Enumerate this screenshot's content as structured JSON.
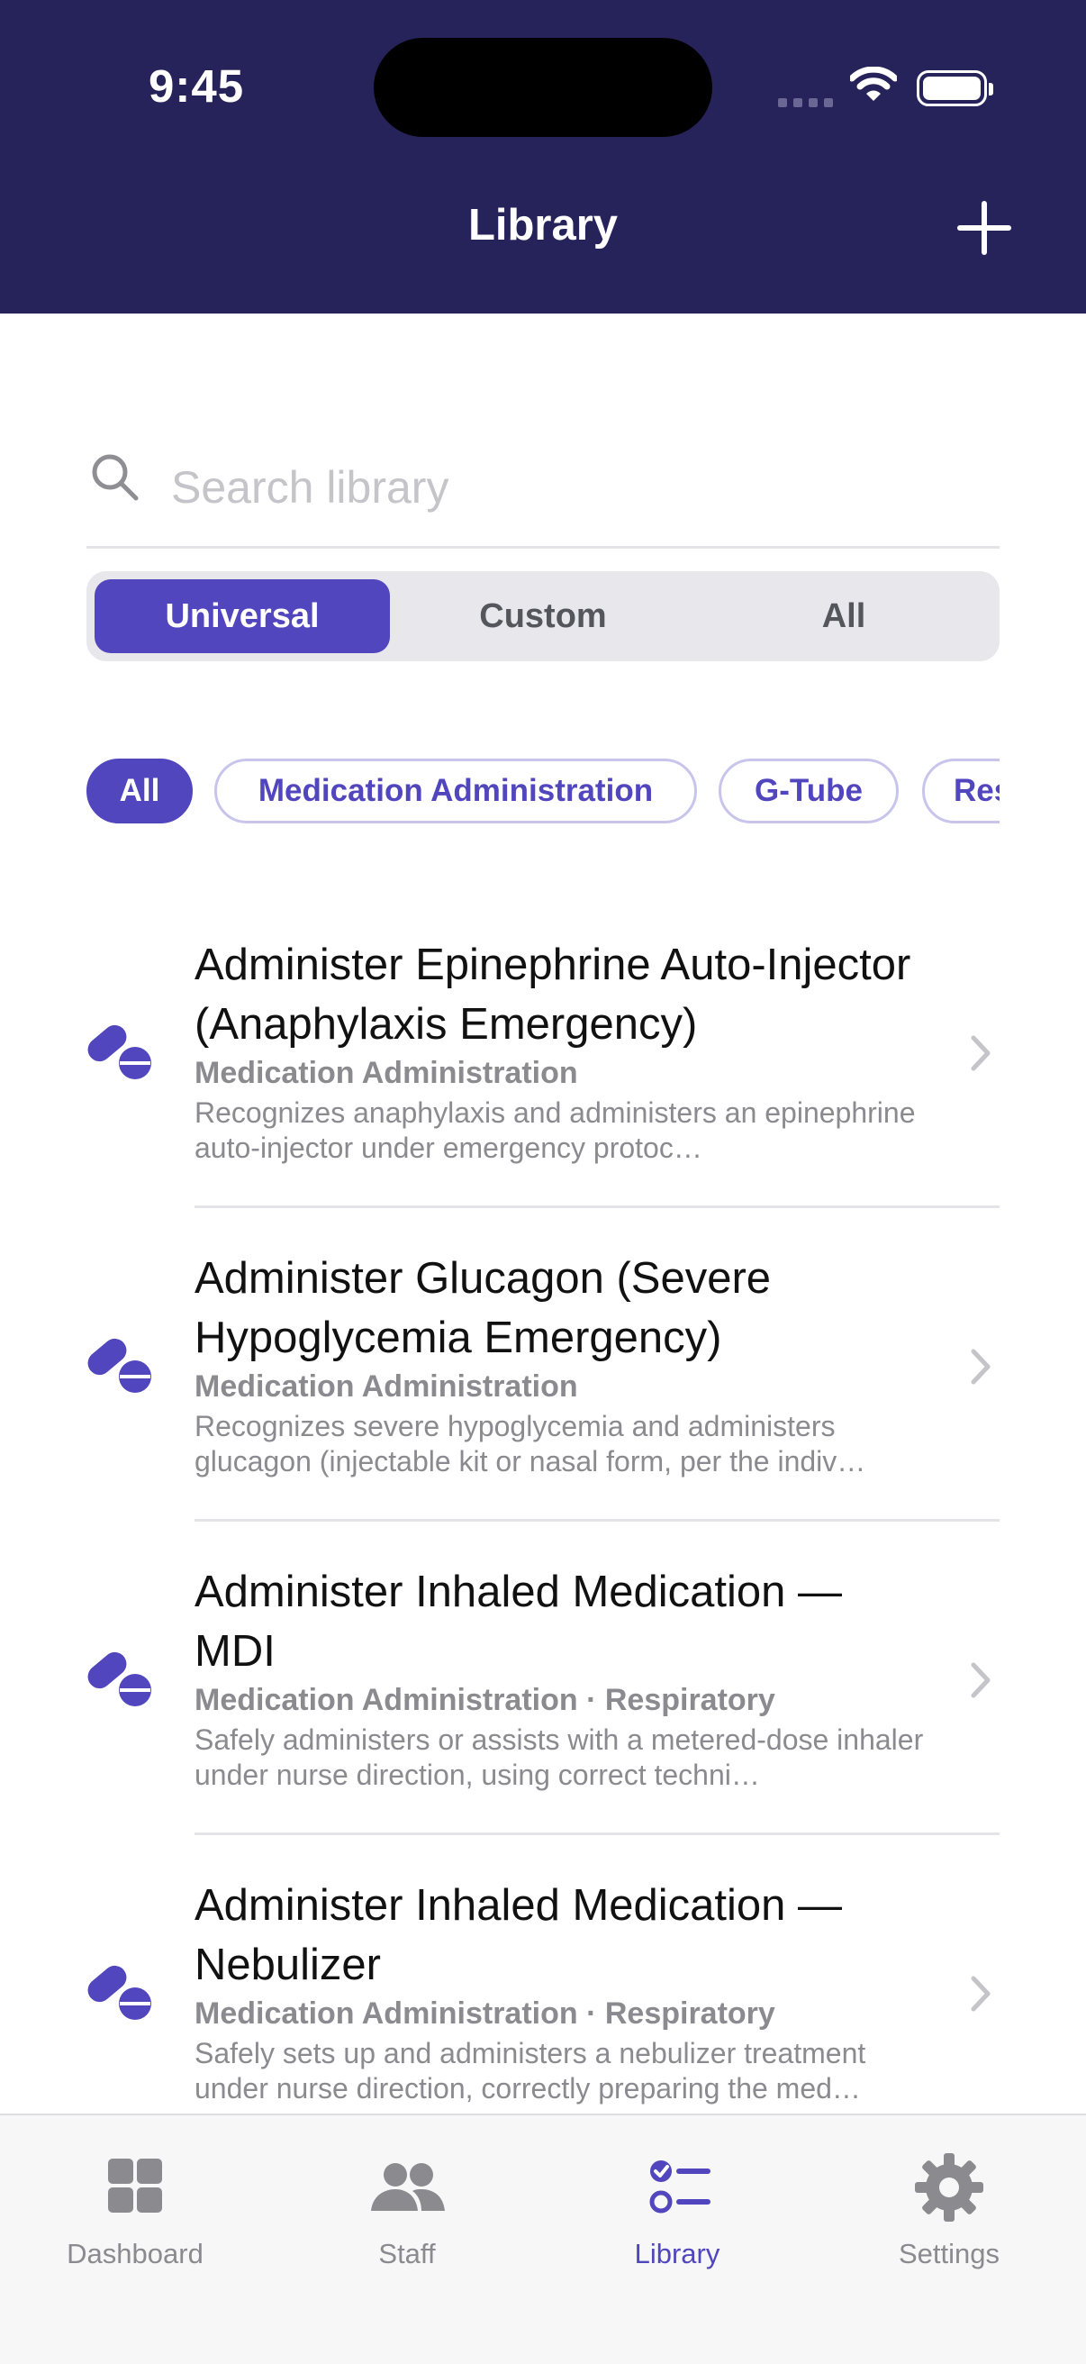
{
  "status_bar": {
    "time": "9:45"
  },
  "header": {
    "title": "Library",
    "add_icon": "plus-icon"
  },
  "search": {
    "placeholder": "Search library",
    "value": ""
  },
  "segments": [
    {
      "label": "Universal",
      "active": true
    },
    {
      "label": "Custom",
      "active": false
    },
    {
      "label": "All",
      "active": false
    }
  ],
  "filter_chips": [
    {
      "label": "All",
      "active": true
    },
    {
      "label": "Medication Administration",
      "active": false
    },
    {
      "label": "G-Tube",
      "active": false
    },
    {
      "label": "Res",
      "active": false
    }
  ],
  "items": [
    {
      "title": "Administer Epinephrine Auto-Injector (Anaphylaxis Emergency)",
      "category": "Medication Administration",
      "description": "Recognizes anaphylaxis and administers an epinephrine auto-injector under emergency protoc…",
      "icon": "pills-icon"
    },
    {
      "title": "Administer Glucagon (Severe Hypoglycemia Emergency)",
      "category": "Medication Administration",
      "description": "Recognizes severe hypoglycemia and administers glucagon (injectable kit or nasal form, per the indiv…",
      "icon": "pills-icon"
    },
    {
      "title": "Administer Inhaled Medication — MDI",
      "category": "Medication Administration · Respiratory",
      "description": "Safely administers or assists with a metered-dose inhaler under nurse direction, using correct techni…",
      "icon": "pills-icon"
    },
    {
      "title": "Administer Inhaled Medication — Nebulizer",
      "category": "Medication Administration · Respiratory",
      "description": "Safely sets up and administers a nebulizer treatment under nurse direction, correctly preparing the med…",
      "icon": "pills-icon"
    }
  ],
  "tabs": [
    {
      "label": "Dashboard",
      "icon": "dashboard-icon",
      "active": false
    },
    {
      "label": "Staff",
      "icon": "staff-icon",
      "active": false
    },
    {
      "label": "Library",
      "icon": "library-icon",
      "active": true
    },
    {
      "label": "Settings",
      "icon": "settings-icon",
      "active": false
    }
  ],
  "colors": {
    "header_bg": "#26225a",
    "accent": "#5146bd"
  }
}
